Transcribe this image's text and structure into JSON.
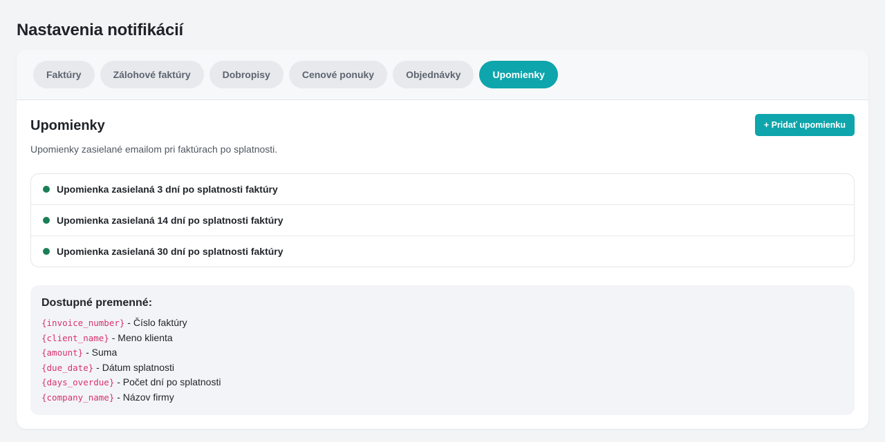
{
  "page": {
    "title": "Nastavenia notifikácií"
  },
  "tabs": [
    {
      "label": "Faktúry",
      "active": false
    },
    {
      "label": "Zálohové faktúry",
      "active": false
    },
    {
      "label": "Dobropisy",
      "active": false
    },
    {
      "label": "Cenové ponuky",
      "active": false
    },
    {
      "label": "Objednávky",
      "active": false
    },
    {
      "label": "Upomienky",
      "active": true
    }
  ],
  "section": {
    "title": "Upomienky",
    "add_button": "+ Pridať upomienku",
    "description": "Upomienky zasielané emailom pri faktúrach po splatnosti."
  },
  "reminders": [
    {
      "label": "Upomienka zasielaná 3 dní po splatnosti faktúry",
      "status_color": "#1a7f55"
    },
    {
      "label": "Upomienka zasielaná 14 dní po splatnosti faktúry",
      "status_color": "#1a7f55"
    },
    {
      "label": "Upomienka zasielaná 30 dní po splatnosti faktúry",
      "status_color": "#1a7f55"
    }
  ],
  "variables": {
    "title": "Dostupné premenné:",
    "items": [
      {
        "code": "{invoice_number}",
        "desc": " - Číslo faktúry"
      },
      {
        "code": "{client_name}",
        "desc": " - Meno klienta"
      },
      {
        "code": "{amount}",
        "desc": " - Suma"
      },
      {
        "code": "{due_date}",
        "desc": " - Dátum splatnosti"
      },
      {
        "code": "{days_overdue}",
        "desc": " - Počet dní po splatnosti"
      },
      {
        "code": "{company_name}",
        "desc": " - Názov firmy"
      }
    ]
  },
  "colors": {
    "accent": "#0ea5ac",
    "status_active": "#1a7f55",
    "variable_code": "#d6336c"
  }
}
